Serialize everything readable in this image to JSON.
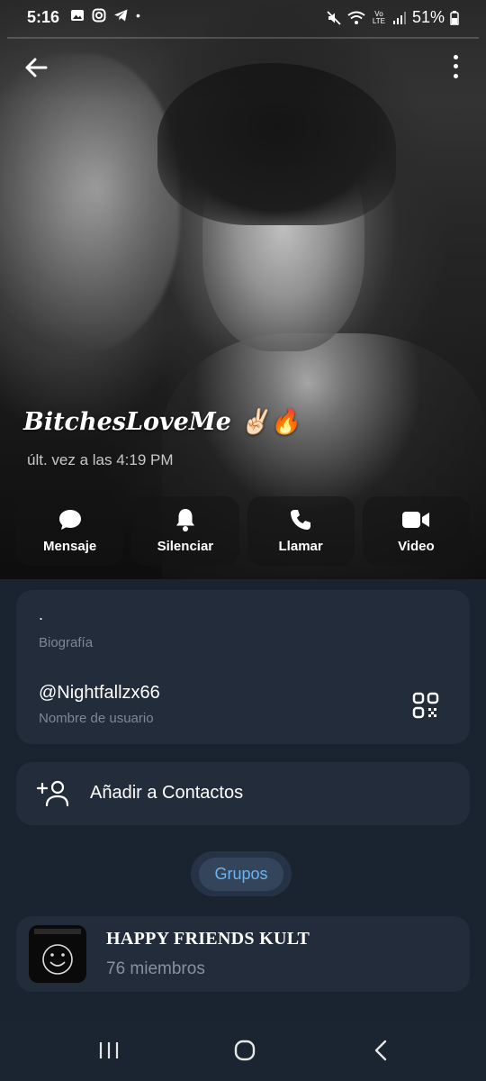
{
  "status_bar": {
    "time": "5:16",
    "battery": "51%",
    "network": "Vo LTE"
  },
  "header": {
    "back_icon": "arrow-left-icon",
    "more_icon": "more-vert-icon"
  },
  "profile": {
    "name": "BitchesLoveMe ✌🏻🔥",
    "last_seen": "últ. vez a las 4:19 PM"
  },
  "actions": [
    {
      "label": "Mensaje",
      "icon": "chat-bubble-icon"
    },
    {
      "label": "Silenciar",
      "icon": "bell-icon"
    },
    {
      "label": "Llamar",
      "icon": "phone-icon"
    },
    {
      "label": "Video",
      "icon": "video-camera-icon"
    }
  ],
  "info": {
    "bio_value": ".",
    "bio_label": "Biografía",
    "username_value": "@Nightfallzx66",
    "username_label": "Nombre de usuario"
  },
  "add_contact": {
    "label": "Añadir a Contactos"
  },
  "tabs": {
    "groups_label": "Grupos"
  },
  "groups": [
    {
      "name": "HAPPY FRIENDS KULT",
      "members": "76 miembros"
    }
  ],
  "colors": {
    "background": "#1a2330",
    "card": "#222c3a",
    "accent": "#6fb3ee",
    "muted": "#7d8896"
  }
}
